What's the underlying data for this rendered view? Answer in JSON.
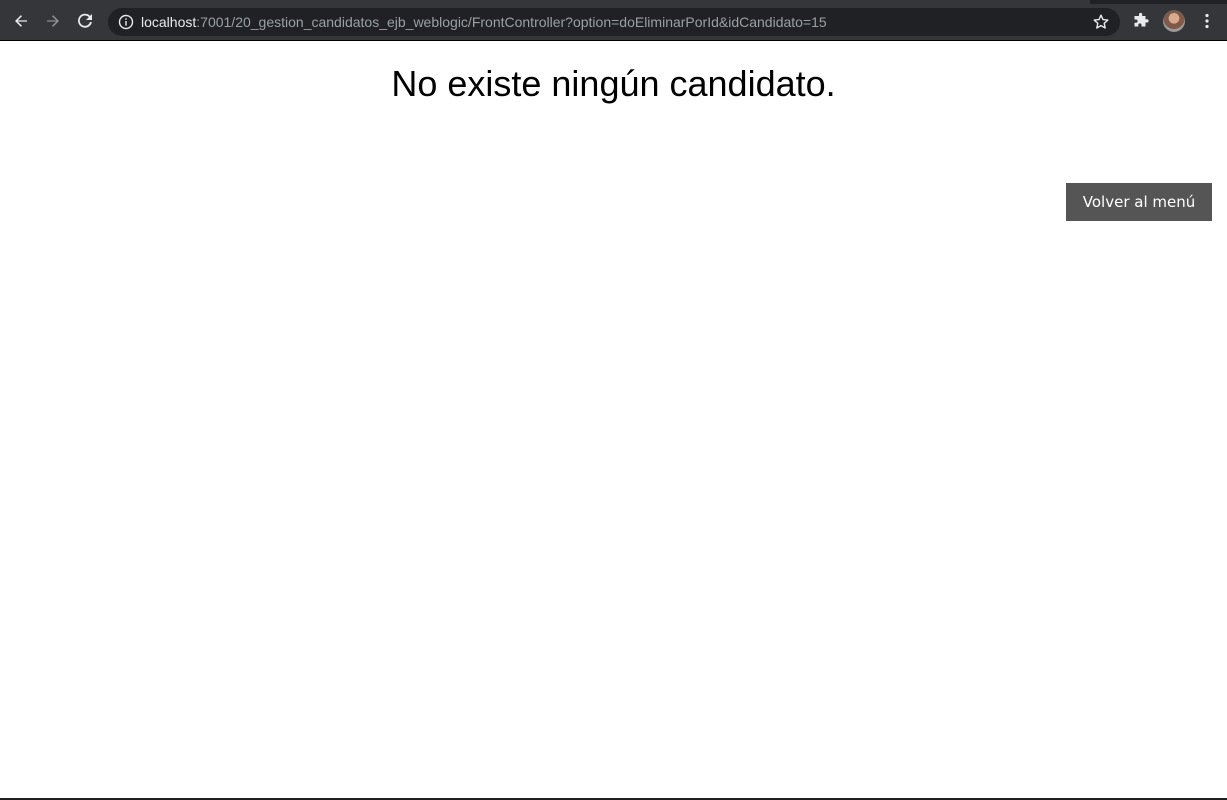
{
  "browser": {
    "url_host": "localhost",
    "url_rest": ":7001/20_gestion_candidatos_ejb_weblogic/FrontController?option=doEliminarPorId&idCandidato=15"
  },
  "page": {
    "message": "No existe ningún candidato.",
    "back_button_label": "Volver al menú"
  }
}
